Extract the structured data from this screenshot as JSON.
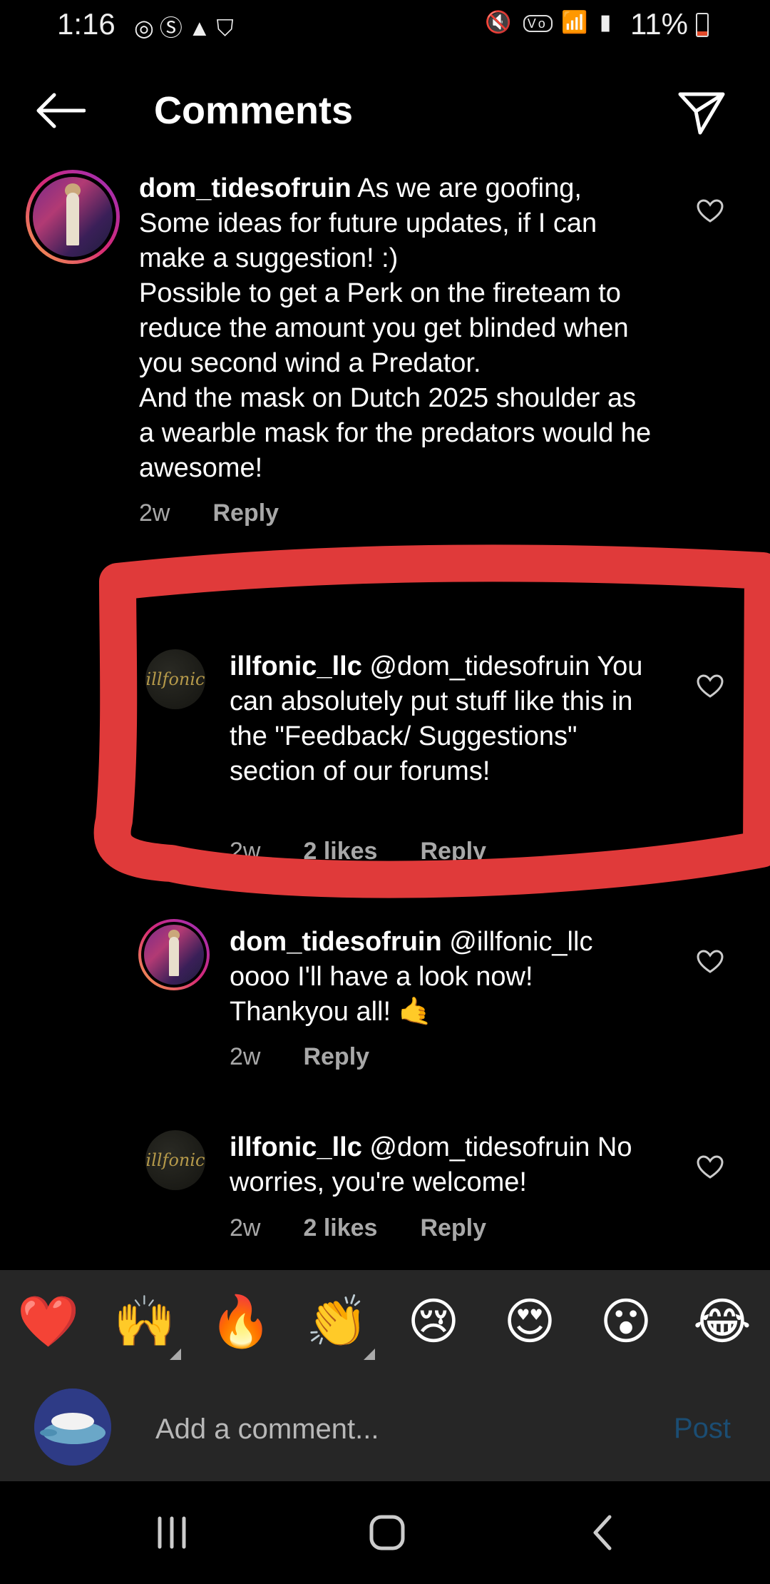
{
  "status": {
    "time": "1:16",
    "battery": "11%",
    "left_icons": [
      "sync-icon",
      "s-icon",
      "warning-icon",
      "shield-wifi-icon"
    ],
    "right_icons": [
      "mute-icon",
      "volte-icon",
      "wifi-icon",
      "signal-icon",
      "battery-icon"
    ]
  },
  "header": {
    "title": "Comments"
  },
  "comments": [
    {
      "username": "dom_tidesofruin",
      "text": "As we are goofing, Some ideas for future updates, if I can make a suggestion! :)\nPossible to get a Perk on the fireteam to reduce the amount you get blinded when you second wind a Predator.\nAnd the mask on Dutch 2025 shoulder as a wearble mask for the predators would he awesome!",
      "time": "2w",
      "reply": "Reply"
    },
    {
      "username": "illfonic_llc",
      "text": "@dom_tidesofruin You can absolutely put stuff like this in the \"Feedback/ Suggestions\" section of our forums!",
      "time": "2w",
      "likes": "2 likes",
      "reply": "Reply"
    },
    {
      "username": "dom_tidesofruin",
      "text": "@illfonic_llc oooo I'll have a look now! Thankyou all! 🤙",
      "time": "2w",
      "reply": "Reply"
    },
    {
      "username": "illfonic_llc",
      "text": "@dom_tidesofruin No worries, you're welcome!",
      "time": "2w",
      "likes": "2 likes",
      "reply": "Reply"
    }
  ],
  "illfonic_avatar_text": "illfonic",
  "emoji_bar": [
    "❤️",
    "🙌",
    "🔥",
    "👏",
    "😢",
    "😍",
    "😮",
    "😂"
  ],
  "composer": {
    "placeholder": "Add a comment...",
    "post_label": "Post"
  },
  "colors": {
    "annotation": "#e03a3a",
    "post_disabled": "#1b4d73"
  }
}
